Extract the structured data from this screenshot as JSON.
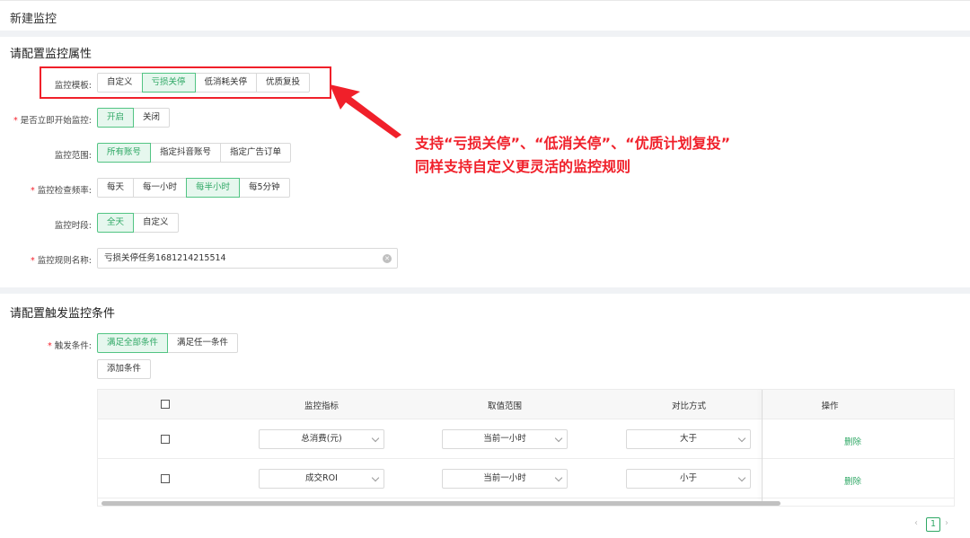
{
  "header": {
    "title": "新建监控"
  },
  "section1": {
    "title": "请配置监控属性",
    "template": {
      "label": "监控模板:",
      "options": [
        "自定义",
        "亏损关停",
        "低消耗关停",
        "优质复投"
      ],
      "selected": 1
    },
    "start_now": {
      "label": "是否立即开始监控:",
      "options": [
        "开启",
        "关闭"
      ],
      "selected": 0
    },
    "scope": {
      "label": "监控范围:",
      "options": [
        "所有账号",
        "指定抖音账号",
        "指定广告订单"
      ],
      "selected": 0
    },
    "frequency": {
      "label": "监控检查频率:",
      "options": [
        "每天",
        "每一小时",
        "每半小时",
        "每5分钟"
      ],
      "selected": 2
    },
    "period": {
      "label": "监控时段:",
      "options": [
        "全天",
        "自定义"
      ],
      "selected": 0
    },
    "rule_name": {
      "label": "监控规则名称:",
      "value": "亏损关停任务1681214215514"
    }
  },
  "callout": {
    "line1": "支持“亏损关停”、“低消关停”、“优质计划复投”",
    "line2": "同样支持自定义更灵活的监控规则"
  },
  "section2": {
    "title": "请配置触发监控条件",
    "trigger": {
      "label": "触发条件:",
      "options": [
        "满足全部条件",
        "满足任一条件"
      ],
      "selected": 0
    },
    "add_button": "添加条件",
    "table": {
      "headers": [
        "监控指标",
        "取值范围",
        "对比方式",
        "操作"
      ],
      "rows": [
        {
          "metric": "总消费(元)",
          "range": "当前一小时",
          "compare": "大于",
          "action": "删除"
        },
        {
          "metric": "成交ROI",
          "range": "当前一小时",
          "compare": "小于",
          "action": "删除"
        }
      ]
    }
  },
  "pagination": {
    "prev": "‹",
    "current": "1",
    "next": "›"
  },
  "colors": {
    "accent": "#2fa865",
    "accent_bg": "#e6f7ee",
    "highlight": "#f0202a"
  }
}
